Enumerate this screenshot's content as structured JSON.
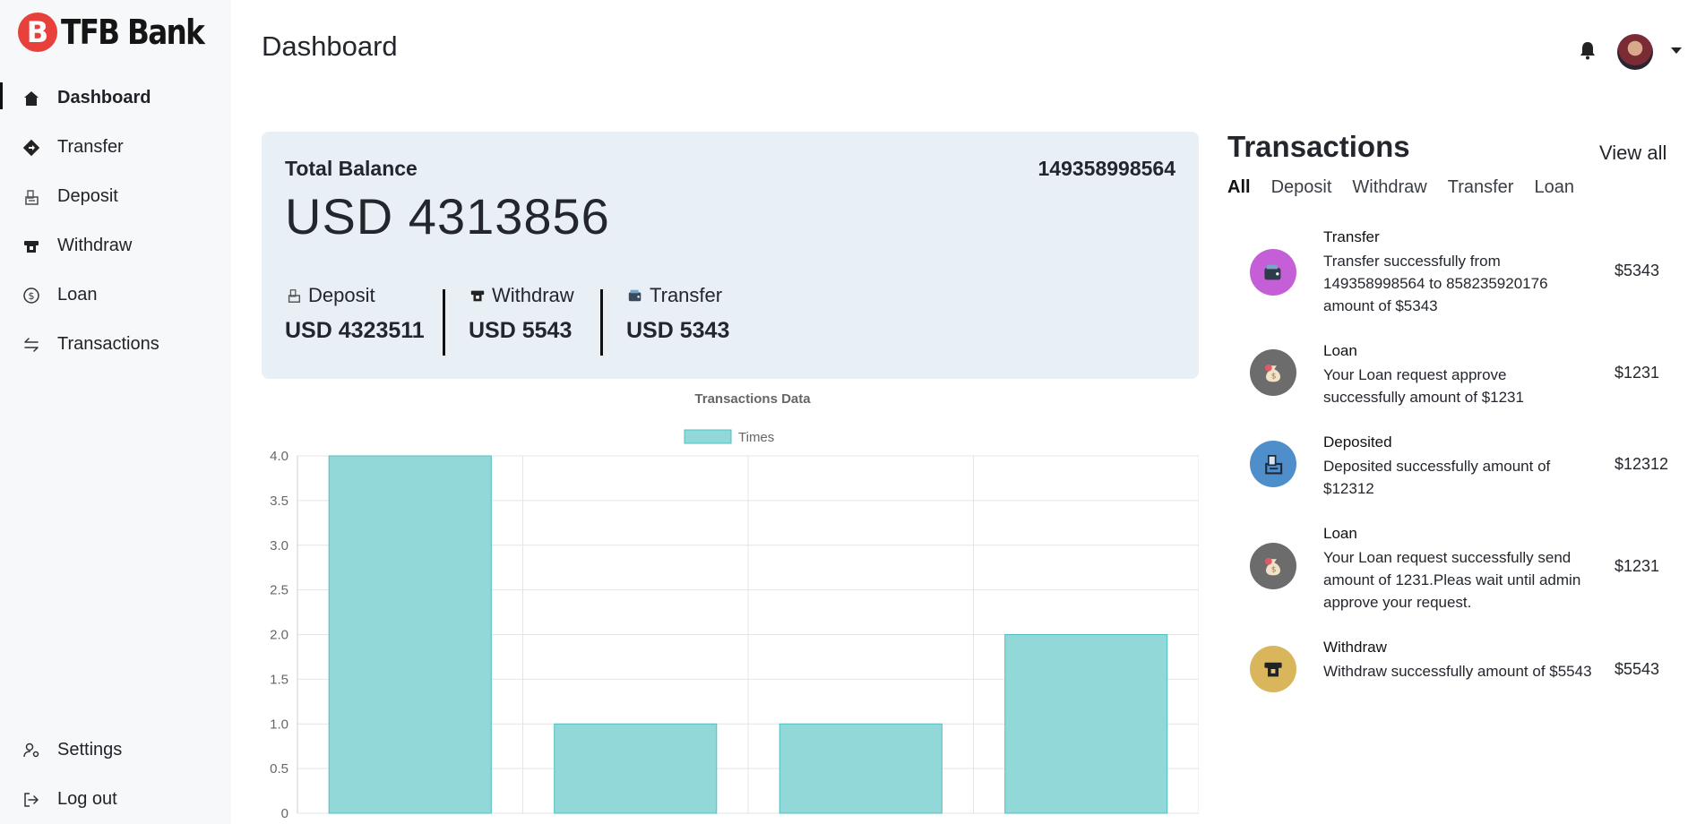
{
  "brand": {
    "mark": "B",
    "name": "TFB Bank",
    "color": "#e8403a"
  },
  "sidebar": {
    "items": [
      {
        "label": "Dashboard",
        "icon": "home-icon",
        "active": true
      },
      {
        "label": "Transfer",
        "icon": "transfer-arrow-icon"
      },
      {
        "label": "Deposit",
        "icon": "deposit-icon"
      },
      {
        "label": "Withdraw",
        "icon": "atm-withdraw-icon"
      },
      {
        "label": "Loan",
        "icon": "dollar-coin-icon"
      },
      {
        "label": "Transactions",
        "icon": "swap-arrows-icon"
      }
    ],
    "bottom": [
      {
        "label": "Settings",
        "icon": "user-settings-icon"
      },
      {
        "label": "Log out",
        "icon": "logout-icon"
      }
    ]
  },
  "header": {
    "title": "Dashboard"
  },
  "balance": {
    "label": "Total Balance",
    "account": "149358998564",
    "amount": "USD 4313856",
    "stats": [
      {
        "label": "Deposit",
        "value": "USD 4323511",
        "icon": "deposit-icon"
      },
      {
        "label": "Withdraw",
        "value": "USD 5543",
        "icon": "atm-withdraw-icon"
      },
      {
        "label": "Transfer",
        "value": "USD 5343",
        "icon": "wallet-icon"
      }
    ]
  },
  "chart_data": {
    "type": "bar",
    "title": "Transactions Data",
    "series": [
      {
        "name": "Times",
        "values": [
          4,
          1,
          1,
          2
        ]
      }
    ],
    "ylim": [
      0,
      4
    ],
    "yticks": [
      "0",
      "0.5",
      "1.0",
      "1.5",
      "2.0",
      "2.5",
      "3.0",
      "3.5",
      "4.0"
    ],
    "grid": true,
    "legend": "top-center",
    "color": "#92d8d8",
    "edge_color": "#4cc0c0"
  },
  "transactions": {
    "title": "Transactions",
    "view_all": "View all",
    "tabs": [
      "All",
      "Deposit",
      "Withdraw",
      "Transfer",
      "Loan"
    ],
    "items": [
      {
        "name": "Transfer",
        "desc": "Transfer successfully from 149358998564 to 858235920176 amount of $5343",
        "amount": "$5343",
        "icon": "wallet-icon",
        "color": "#c45fd8"
      },
      {
        "name": "Loan",
        "desc": "Your Loan request approve successfully amount of $1231",
        "amount": "$1231",
        "icon": "money-bag-icon",
        "color": "#6c6c6c"
      },
      {
        "name": "Deposited",
        "desc": "Deposited successfully amount of $12312",
        "amount": "$12312",
        "icon": "deposit-icon",
        "color": "#4d8ecb"
      },
      {
        "name": "Loan",
        "desc": "Your Loan request successfully send amount of 1231.Pleas wait until admin approve your request.",
        "amount": "$1231",
        "icon": "money-bag-icon",
        "color": "#6c6c6c"
      },
      {
        "name": "Withdraw",
        "desc": "Withdraw successfully amount of $5543",
        "amount": "$5543",
        "icon": "atm-withdraw-icon",
        "color": "#d9b65c"
      }
    ]
  }
}
